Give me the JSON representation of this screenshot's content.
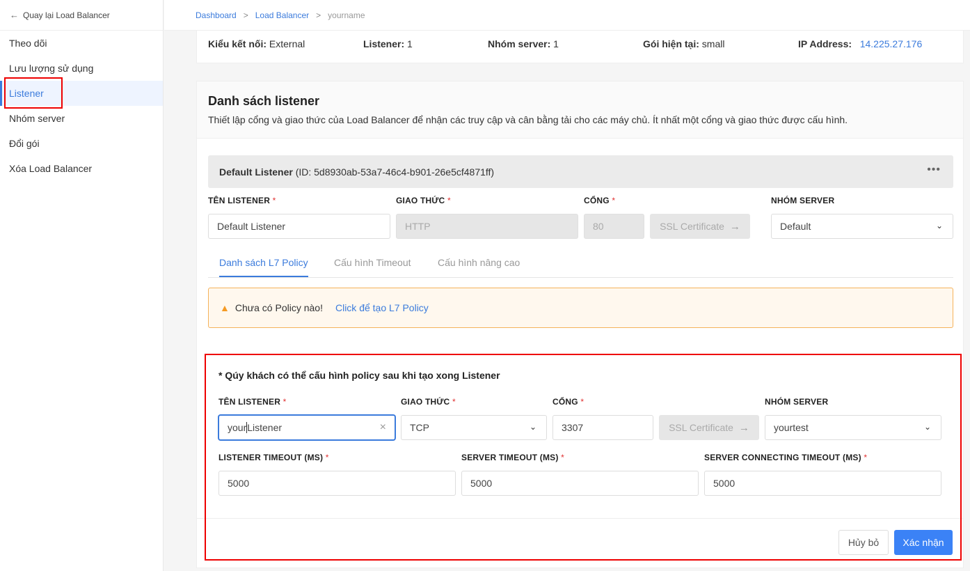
{
  "sidebar": {
    "back_label": "Quay lại Load Balancer",
    "items": [
      {
        "label": "Theo dõi"
      },
      {
        "label": "Lưu lượng sử dụng"
      },
      {
        "label": "Listener"
      },
      {
        "label": "Nhóm server"
      },
      {
        "label": "Đổi gói"
      },
      {
        "label": "Xóa Load Balancer"
      }
    ],
    "active": "Listener"
  },
  "breadcrumb": {
    "items": [
      "Dashboard",
      "Load Balancer",
      "yourname"
    ],
    "separator": ">"
  },
  "info": {
    "connection_type_label": "Kiểu kết nối:",
    "connection_type_value": "External",
    "listener_label": "Listener:",
    "listener_value": "1",
    "server_group_label": "Nhóm server:",
    "server_group_value": "1",
    "plan_label": "Gói hiện tại:",
    "plan_value": "small",
    "ip_label": "IP Address:",
    "ip_value": "14.225.27.176"
  },
  "listeners_section": {
    "title": "Danh sách listener",
    "description": "Thiết lập cổng và giao thức của Load Balancer để nhận các truy cập và cân bằng tải cho các máy chủ. Ít nhất một cổng và giao thức được cấu hình."
  },
  "default_listener": {
    "name": "Default Listener",
    "id_text": "(ID: 5d8930ab-53a7-46c4-b901-26e5cf4871ff)",
    "menu": "•••",
    "labels": {
      "name": "TÊN LISTENER",
      "protocol": "GIAO THỨC",
      "port": "CỔNG",
      "server_group": "NHÓM SERVER",
      "required": "*"
    },
    "name_value": "Default Listener",
    "protocol_value": "HTTP",
    "port_value": "80",
    "ssl_label": "SSL Certificate",
    "server_group_value": "Default"
  },
  "tabs": [
    {
      "label": "Danh sách L7 Policy"
    },
    {
      "label": "Cấu hình Timeout"
    },
    {
      "label": "Cấu hình nâng cao"
    }
  ],
  "warning": {
    "text": "Chưa có Policy nào!",
    "link": "Click để tạo L7 Policy"
  },
  "new_listener": {
    "note": "* Qúy khách có thể cấu hình policy sau khi tạo xong Listener",
    "labels": {
      "name": "TÊN LISTENER",
      "protocol": "GIAO THỨC",
      "port": "CỔNG",
      "server_group": "NHÓM SERVER",
      "listener_timeout": "LISTENER TIMEOUT (MS)",
      "server_timeout": "SERVER TIMEOUT (MS)",
      "server_connecting_timeout": "SERVER CONNECTING TIMEOUT (MS)",
      "required": "*"
    },
    "name_value_before_cursor": "your",
    "name_value_after_cursor": "Listener",
    "protocol_value": "TCP",
    "port_value": "3307",
    "ssl_label": "SSL Certificate",
    "server_group_value": "yourtest",
    "listener_timeout_value": "5000",
    "server_timeout_value": "5000",
    "server_connecting_timeout_value": "5000"
  },
  "actions": {
    "cancel": "Hủy bỏ",
    "confirm": "Xác nhận"
  }
}
